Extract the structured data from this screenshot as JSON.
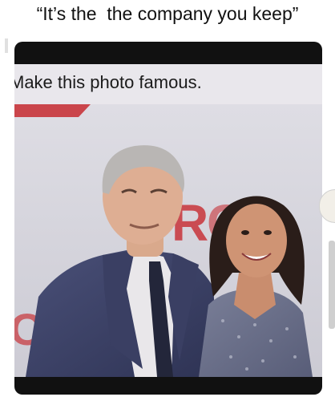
{
  "caption": "“It’s the  the company you keep”",
  "post_text": "Make this photo famous.",
  "colors": {
    "frame": "#111111",
    "suit": "#3c4166",
    "backdrop": "#d9d8df",
    "red_logo": "#c8343a"
  },
  "icons": {
    "side_button": "round-icon"
  }
}
